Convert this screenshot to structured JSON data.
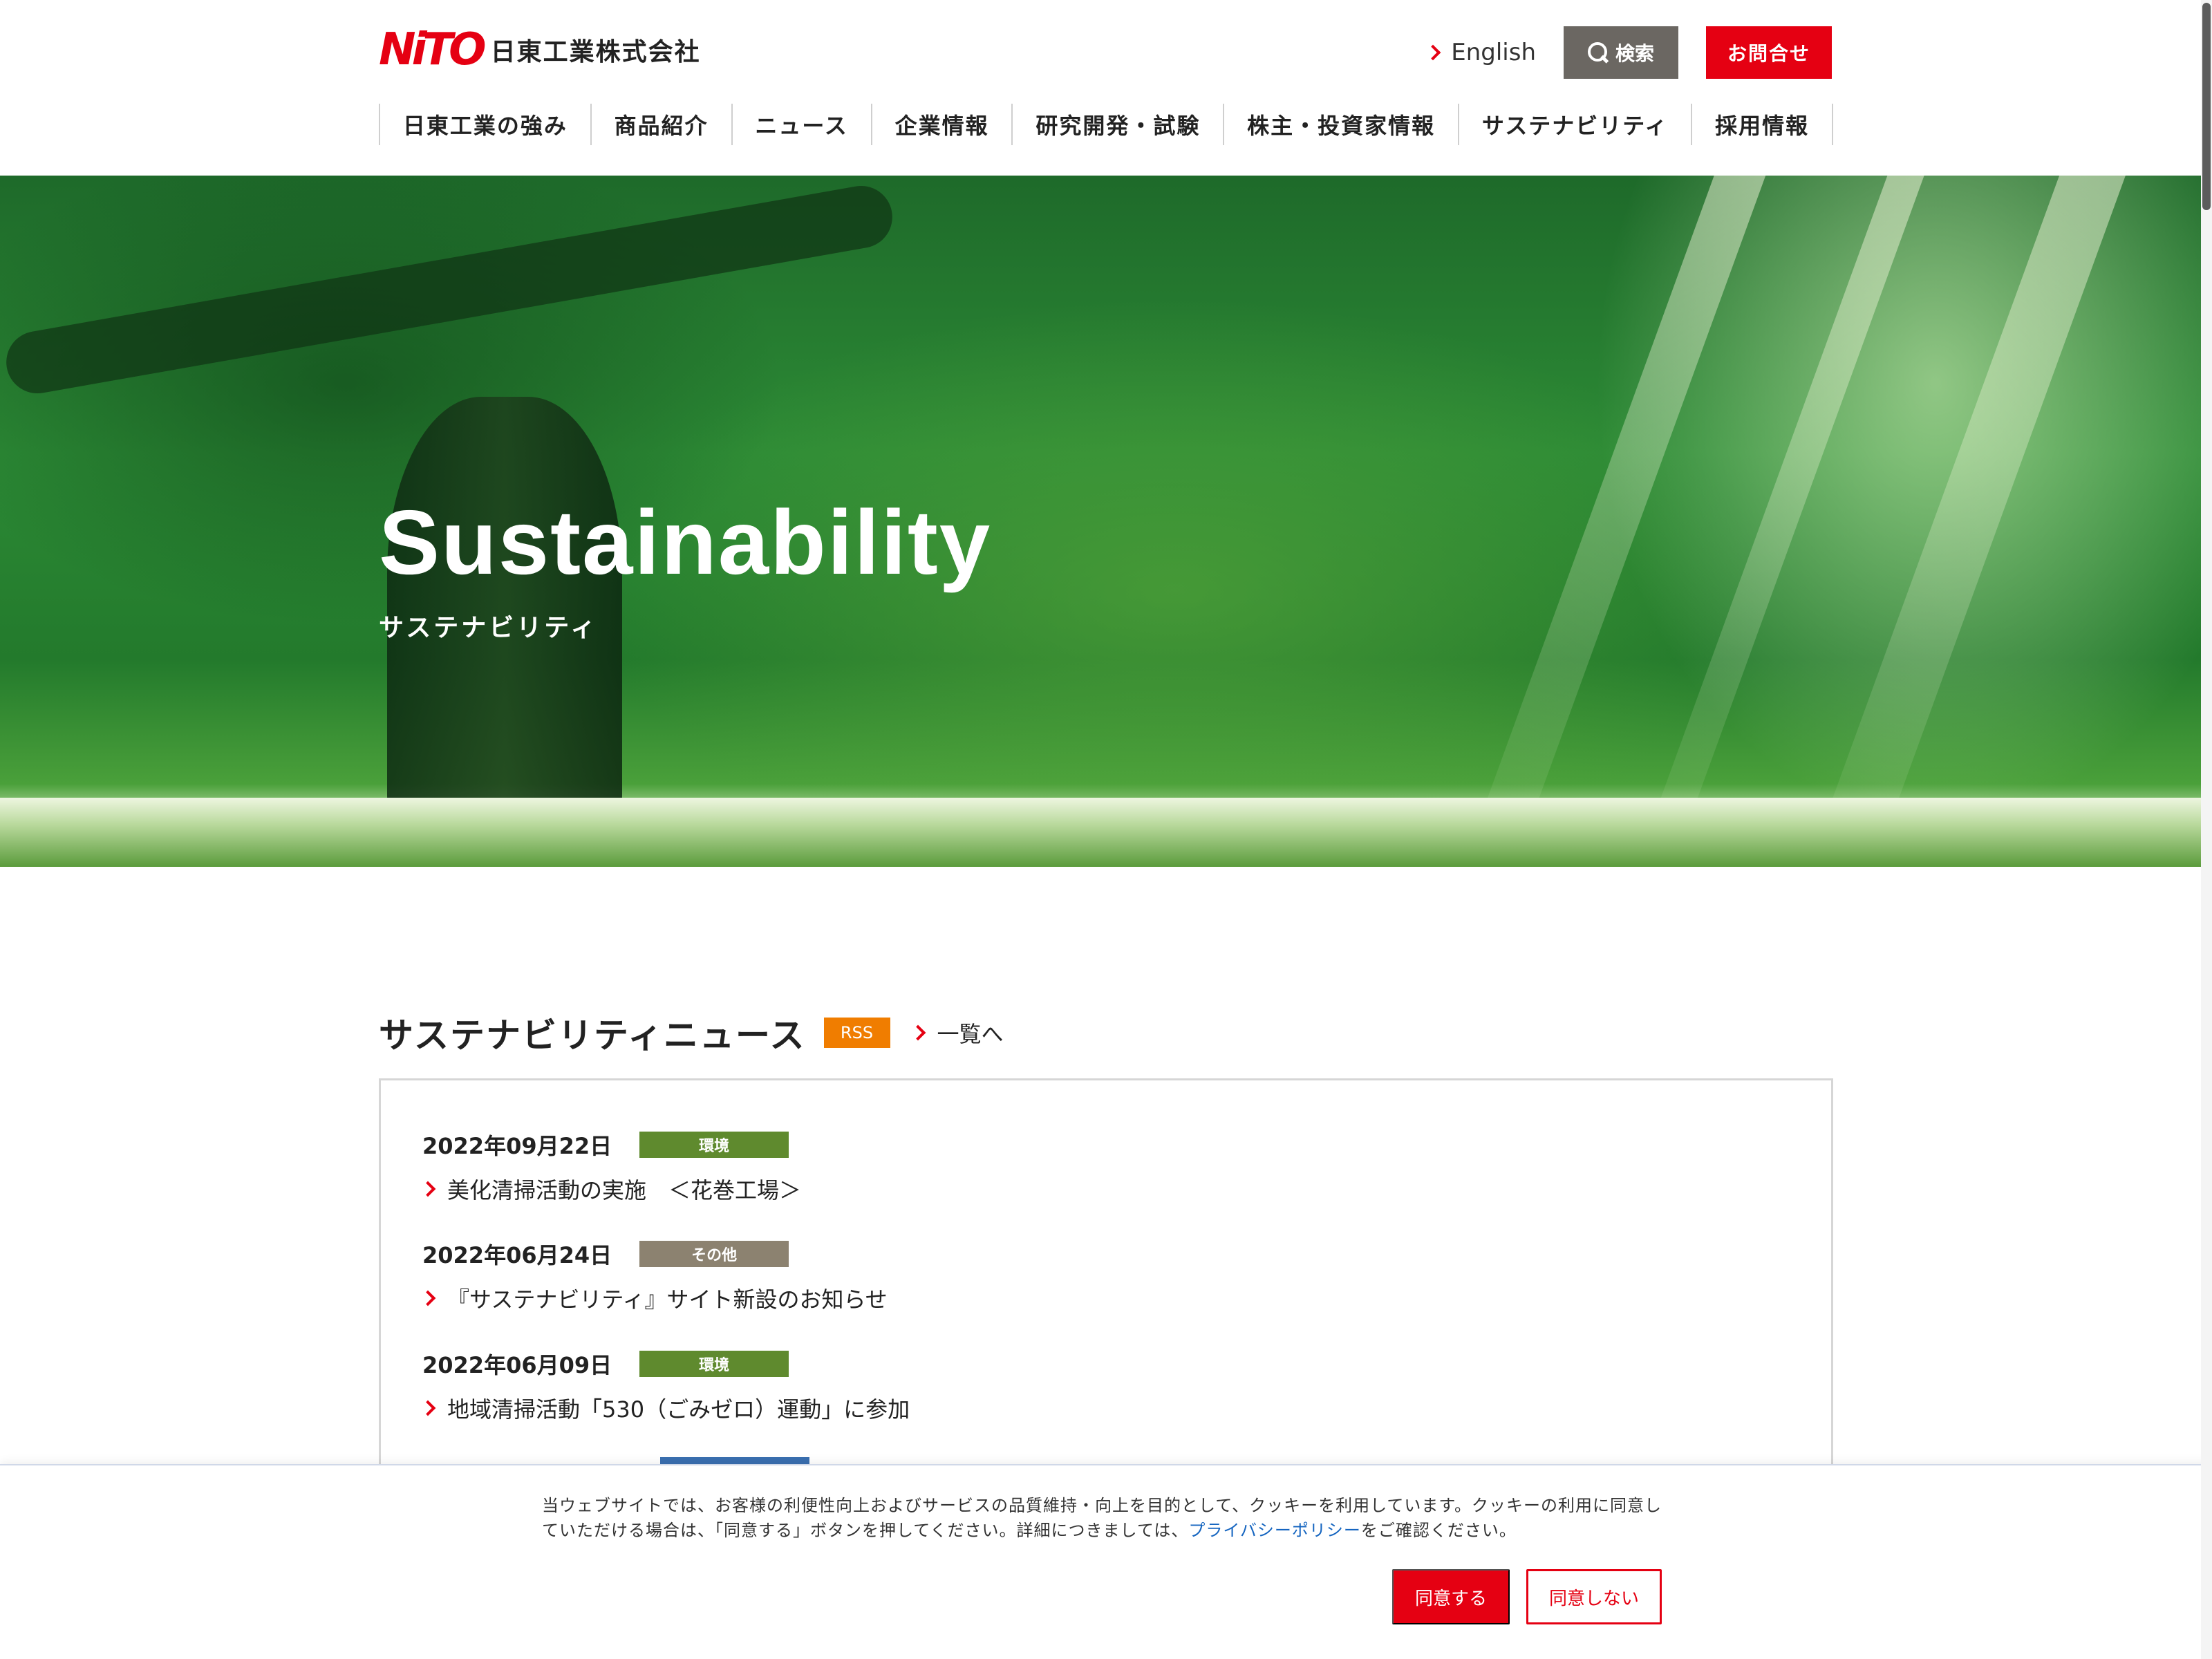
{
  "header": {
    "logo_mark": "NiTO",
    "logo_text": "日東工業株式会社",
    "english_label": "English",
    "search_label": "検索",
    "contact_label": "お問合せ"
  },
  "nav": [
    "日東工業の強み",
    "商品紹介",
    "ニュース",
    "企業情報",
    "研究開発・試験",
    "株主・投資家情報",
    "サステナビリティ",
    "採用情報"
  ],
  "hero": {
    "title": "Sustainability",
    "subtitle": "サステナビリティ"
  },
  "news": {
    "title": "サステナビリティニュース",
    "rss_label": "RSS",
    "more_label": "一覧へ",
    "items": [
      {
        "date": "2022年09月22日",
        "tag": "環境",
        "tag_color": "#5f8a2e",
        "title": "美化清掃活動の実施　＜花巻工場＞"
      },
      {
        "date": "2022年06月24日",
        "tag": "その他",
        "tag_color": "#8c8270",
        "title": "『サステナビリティ』サイト新設のお知らせ"
      },
      {
        "date": "2022年06月09日",
        "tag": "環境",
        "tag_color": "#5f8a2e",
        "title": "地域清掃活動「530（ごみゼロ）運動」に参加"
      }
    ]
  },
  "cookie": {
    "text_1": "当ウェブサイトでは、お客様の利便性向上およびサービスの品質維持・向上を目的として、クッキーを利用しています。クッキーの利用に同意していただける場合は、「同意する」ボタンを押してください。詳細につきましては、",
    "link": "プライバシーポリシー",
    "text_2": "をご確認ください。",
    "agree_label": "同意する",
    "deny_label": "同意しない"
  },
  "colors": {
    "brand_red": "#e50012",
    "rss_orange": "#f07d00",
    "search_gray": "#6b6762"
  }
}
